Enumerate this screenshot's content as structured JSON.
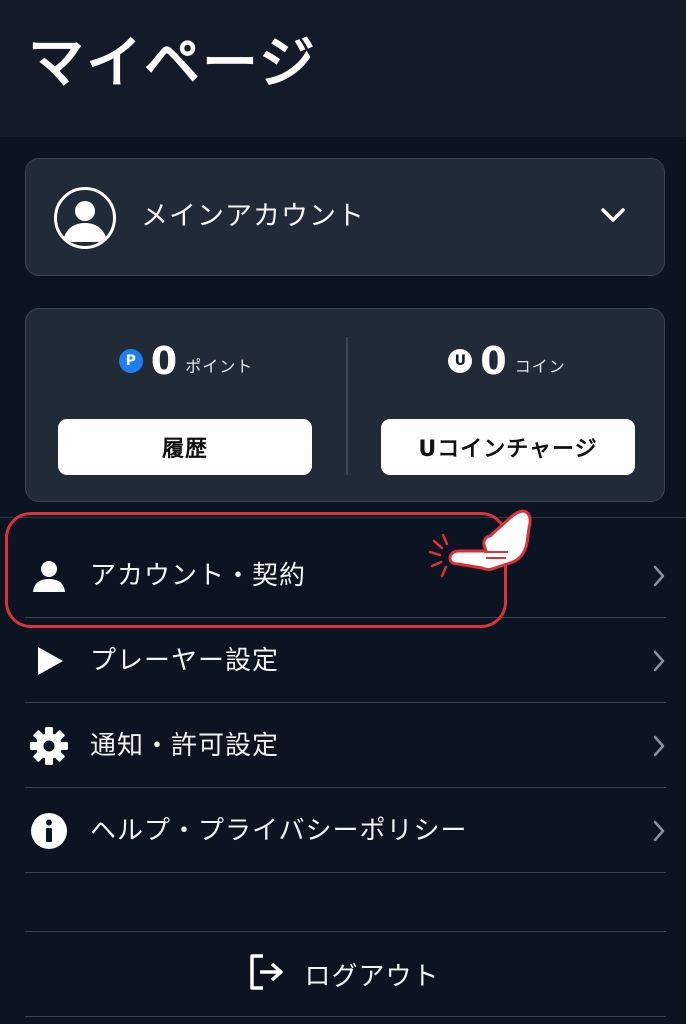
{
  "header": {
    "title": "マイページ"
  },
  "account": {
    "name": "メインアカウント"
  },
  "balance": {
    "points": {
      "value": "0",
      "unit": "ポイント",
      "icon_letter": "P",
      "button": "履歴"
    },
    "coins": {
      "value": "0",
      "unit": "コイン",
      "icon_letter": "U",
      "button": "Uコインチャージ"
    }
  },
  "menu": [
    {
      "label": "アカウント・契約",
      "icon": "person-icon"
    },
    {
      "label": "プレーヤー設定",
      "icon": "play-icon"
    },
    {
      "label": "通知・許可設定",
      "icon": "gear-icon"
    },
    {
      "label": "ヘルプ・プライバシーポリシー",
      "icon": "info-icon"
    }
  ],
  "logout": {
    "label": "ログアウト"
  },
  "colors": {
    "background": "#0b1420",
    "card": "#212b37",
    "highlight": "#d9323a",
    "point_blue": "#1b7ff0"
  }
}
